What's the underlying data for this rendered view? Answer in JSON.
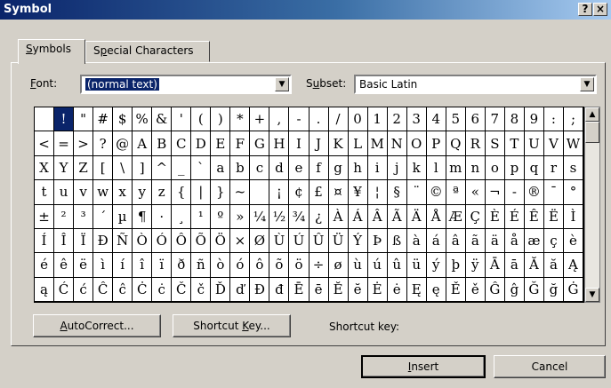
{
  "window": {
    "title": "Symbol",
    "help_glyph": "?",
    "close_glyph": "×"
  },
  "tabs": [
    {
      "label": "Symbols",
      "mnemonic": "S",
      "rest": "ymbols"
    },
    {
      "label": "Special Characters",
      "pre": "S",
      "mnemonic": "p",
      "rest": "ecial Characters"
    }
  ],
  "font": {
    "label_mnemonic": "F",
    "label_rest": "ont:",
    "value": "(normal text)"
  },
  "subset": {
    "label_pre": "S",
    "label_mnemonic": "u",
    "label_rest": "bset:",
    "value": "Basic Latin"
  },
  "symbol_grid": {
    "selected": "!",
    "rows": [
      [
        " ",
        "!",
        "\"",
        "#",
        "$",
        "%",
        "&",
        "'",
        "(",
        ")",
        "*",
        "+",
        ",",
        "-",
        ".",
        "/",
        "0",
        "1",
        "2",
        "3",
        "4",
        "5",
        "6",
        "7",
        "8",
        "9",
        ":",
        ";"
      ],
      [
        "<",
        "=",
        ">",
        "?",
        "@",
        "A",
        "B",
        "C",
        "D",
        "E",
        "F",
        "G",
        "H",
        "I",
        "J",
        "K",
        "L",
        "M",
        "N",
        "O",
        "P",
        "Q",
        "R",
        "S",
        "T",
        "U",
        "V",
        "W"
      ],
      [
        "X",
        "Y",
        "Z",
        "[",
        "\\",
        "]",
        "^",
        "_",
        "`",
        "a",
        "b",
        "c",
        "d",
        "e",
        "f",
        "g",
        "h",
        "i",
        "j",
        "k",
        "l",
        "m",
        "n",
        "o",
        "p",
        "q",
        "r",
        "s"
      ],
      [
        "t",
        "u",
        "v",
        "w",
        "x",
        "y",
        "z",
        "{",
        "|",
        "}",
        "~",
        "",
        "¡",
        "¢",
        "£",
        "¤",
        "¥",
        "¦",
        "§",
        "¨",
        "©",
        "ª",
        "«",
        "¬",
        "-",
        "®",
        "¯",
        "°"
      ],
      [
        "±",
        "²",
        "³",
        "´",
        "µ",
        "¶",
        "·",
        "¸",
        "¹",
        "º",
        "»",
        "¼",
        "½",
        "¾",
        "¿",
        "À",
        "Á",
        "Â",
        "Ã",
        "Ä",
        "Å",
        "Æ",
        "Ç",
        "È",
        "É",
        "Ê",
        "Ë",
        "Ì"
      ],
      [
        "Í",
        "Î",
        "Ï",
        "Ð",
        "Ñ",
        "Ò",
        "Ó",
        "Ô",
        "Õ",
        "Ö",
        "×",
        "Ø",
        "Ù",
        "Ú",
        "Û",
        "Ü",
        "Ý",
        "Þ",
        "ß",
        "à",
        "á",
        "â",
        "ã",
        "ä",
        "å",
        "æ",
        "ç",
        "è"
      ],
      [
        "é",
        "ê",
        "ë",
        "ì",
        "í",
        "î",
        "ï",
        "ð",
        "ñ",
        "ò",
        "ó",
        "ô",
        "õ",
        "ö",
        "÷",
        "ø",
        "ù",
        "ú",
        "û",
        "ü",
        "ý",
        "þ",
        "ÿ",
        "Ā",
        "ā",
        "Ă",
        "ă",
        "Ą"
      ],
      [
        "ą",
        "Ć",
        "ć",
        "Ĉ",
        "ĉ",
        "Ċ",
        "ċ",
        "Č",
        "č",
        "Ď",
        "ď",
        "Đ",
        "đ",
        "Ē",
        "ē",
        "Ĕ",
        "ĕ",
        "Ė",
        "ė",
        "Ę",
        "ę",
        "Ě",
        "ě",
        "Ĝ",
        "ĝ",
        "Ğ",
        "ğ",
        "Ġ"
      ]
    ]
  },
  "buttons": {
    "autocorrect": {
      "mnemonic": "A",
      "rest": "utoCorrect..."
    },
    "shortcut_key": {
      "pre": "Shortcut ",
      "mnemonic": "K",
      "rest": "ey..."
    },
    "insert": {
      "mnemonic": "I",
      "rest": "nsert"
    },
    "cancel": "Cancel"
  },
  "shortcut_label": "Shortcut key:",
  "icons": {
    "dropdown": "▼",
    "scroll_up": "▲",
    "scroll_down": "▼"
  }
}
